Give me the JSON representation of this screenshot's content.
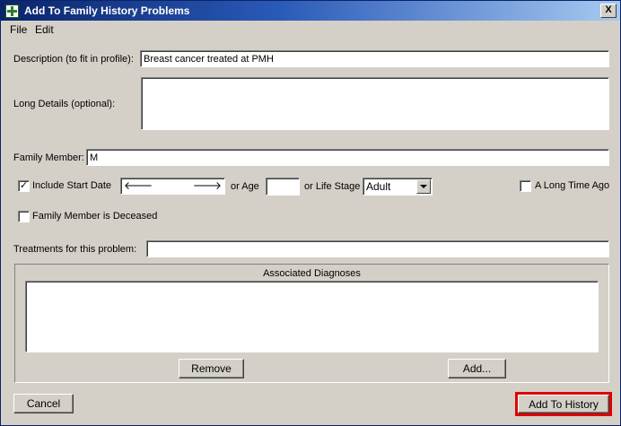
{
  "window": {
    "title": "Add To Family History Problems",
    "close_label": "X"
  },
  "menu": {
    "items": [
      "File",
      "Edit"
    ]
  },
  "form": {
    "description_label": "Description (to fit in profile):",
    "description_value": "Breast cancer treated at PMH",
    "long_details_label": "Long Details (optional):",
    "long_details_value": "",
    "family_member_label": "Family Member:",
    "family_member_value": "M",
    "include_start_date_label": "Include Start Date",
    "include_start_date_checked": true,
    "or_age_label": "or Age",
    "age_value": "",
    "or_life_stage_label": "or Life Stage",
    "life_stage_value": "Adult",
    "long_time_ago_label": "A Long Time Ago",
    "long_time_ago_checked": false,
    "deceased_label": "Family Member is Deceased",
    "deceased_checked": false,
    "treatments_label": "Treatments for this problem:",
    "treatments_value": ""
  },
  "diagnoses": {
    "title": "Associated Diagnoses",
    "items": [],
    "remove_label": "Remove",
    "add_label": "Add..."
  },
  "footer": {
    "cancel_label": "Cancel",
    "add_to_history_label": "Add To History"
  },
  "colors": {
    "title_bar": "#0a246a",
    "window_bg": "#d4d0c8",
    "highlight_outline": "#e00000"
  }
}
